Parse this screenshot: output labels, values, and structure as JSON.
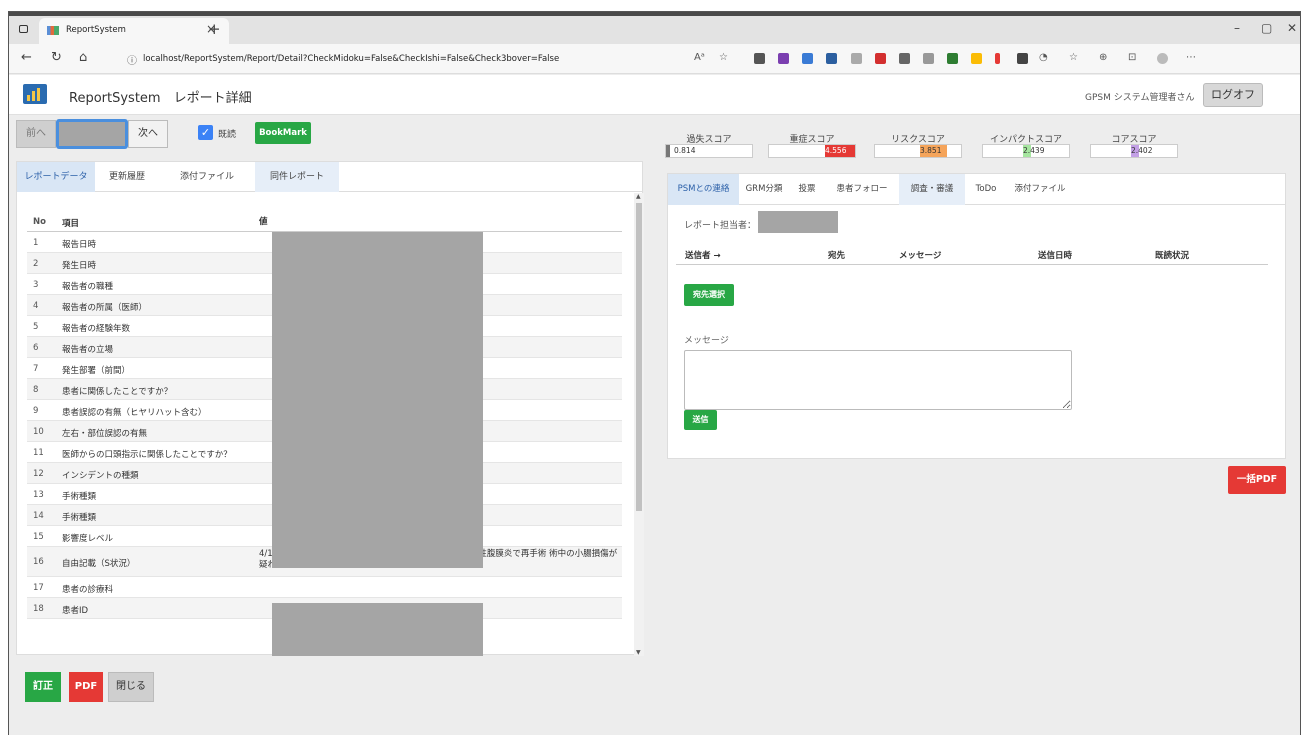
{
  "browser": {
    "tab_title": "ReportSystem",
    "tab_close": "×",
    "new_tab": "+",
    "url": "localhost/ReportSystem/Report/Detail?CheckMidoku=False&CheckIshi=False&Check3bover=False",
    "minimize": "–",
    "maximize": "▢",
    "close": "✕"
  },
  "app": {
    "title": "ReportSystem　レポート詳細",
    "user": "GPSM システム管理者さん",
    "logout": "ログオフ"
  },
  "nav": {
    "prev": "前へ",
    "next": "次へ",
    "read_label": "既読",
    "read_checked": true,
    "bookmark": "BookMark"
  },
  "left_tabs": [
    "レポートデータ",
    "更新履歴",
    "添付ファイル",
    "同件レポート"
  ],
  "table": {
    "headers": [
      "No",
      "項目",
      "値"
    ],
    "rows": [
      {
        "no": "1",
        "item": "報告日時",
        "value": ""
      },
      {
        "no": "2",
        "item": "発生日時",
        "value": ""
      },
      {
        "no": "3",
        "item": "報告者の職種",
        "value": ""
      },
      {
        "no": "4",
        "item": "報告者の所属（医師）",
        "value": ""
      },
      {
        "no": "5",
        "item": "報告者の経験年数",
        "value": ""
      },
      {
        "no": "6",
        "item": "報告者の立場",
        "value": ""
      },
      {
        "no": "7",
        "item": "発生部署（前間）",
        "value": ""
      },
      {
        "no": "8",
        "item": "患者に関係したことですか？",
        "value": ""
      },
      {
        "no": "9",
        "item": "患者誤認の有無（ヒヤリハット含む）",
        "value": ""
      },
      {
        "no": "10",
        "item": "左右・部位誤認の有無",
        "value": ""
      },
      {
        "no": "11",
        "item": "医師からの口頭指示に関係したことですか？",
        "value": ""
      },
      {
        "no": "12",
        "item": "インシデントの種類",
        "value": ""
      },
      {
        "no": "13",
        "item": "手術種類",
        "value": ""
      },
      {
        "no": "14",
        "item": "手術種類",
        "value": ""
      },
      {
        "no": "15",
        "item": "影響度レベル",
        "value": ""
      },
      {
        "no": "16",
        "item": "自由記載（S状況）",
        "value": "4/11　単孔式腹腔鏡下胆嚢摘出術 4/15　小腸穿孔　限局性腹膜炎で再手術 術中の小腸損傷が疑われる"
      },
      {
        "no": "17",
        "item": "患者の診療科",
        "value": ""
      },
      {
        "no": "18",
        "item": "患者ID",
        "value": ""
      }
    ]
  },
  "bottom_buttons": {
    "correct": "訂正",
    "pdf": "PDF",
    "close": "閉じる"
  },
  "scores": [
    {
      "label": "過失スコア",
      "value": "0.814",
      "color": "#777777",
      "fill": 0.05
    },
    {
      "label": "重症スコア",
      "value": "4.556",
      "color": "#e53935",
      "fill": 0.65
    },
    {
      "label": "リスクスコア",
      "value": "3.851",
      "color": "#f5a45a",
      "fill": 0.5
    },
    {
      "label": "インパクトスコア",
      "value": "2.439",
      "color": "#a6e6a0",
      "fill": 0.32
    },
    {
      "label": "コアスコア",
      "value": "2.402",
      "color": "#c3a0e6",
      "fill": 0.3
    }
  ],
  "right_tabs": [
    "PSMとの連絡",
    "GRM分類",
    "投票",
    "患者フォロー",
    "調査・審議",
    "ToDo",
    "添付ファイル"
  ],
  "contact": {
    "reporter_label": "レポート担当者：",
    "headers": [
      "送信者 →",
      "宛先",
      "メッセージ",
      "送信日時",
      "既読状況"
    ],
    "dest_button": "宛先選択",
    "message_label": "メッセージ",
    "send_button": "送信"
  },
  "batch_pdf": "一括PDF"
}
